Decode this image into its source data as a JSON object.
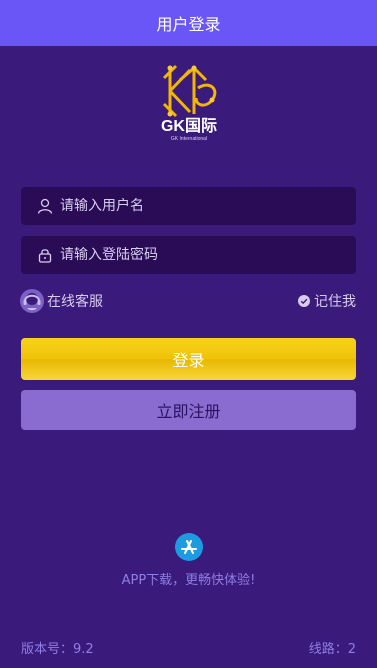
{
  "header": {
    "title": "用户登录"
  },
  "logo": {
    "name": "GK国际",
    "sub": "GK International"
  },
  "form": {
    "username_placeholder": "请输入用户名",
    "username_value": "",
    "password_placeholder": "请输入登陆密码",
    "password_value": ""
  },
  "links": {
    "customer_service": "在线客服",
    "remember_me": "记住我",
    "remember_checked": true
  },
  "buttons": {
    "login": "登录",
    "register": "立即注册"
  },
  "app": {
    "text": "APP下载，更畅快体验!"
  },
  "footer": {
    "version": "版本号：9.2",
    "line": "线路：2"
  },
  "icons": {
    "username": "user-icon",
    "password": "lock-icon",
    "customer_service": "headset-icon",
    "remember": "check-circle-icon",
    "app": "app-store-icon",
    "logo": "gk-logo-icon"
  },
  "colors": {
    "background": "#3a1a7a",
    "header": "#6a56f6",
    "input_bg": "#2a0c56",
    "login_button": "#f0c20a",
    "register_button": "#8a6cd0",
    "accent_text": "#8f7ee6",
    "app_icon": "#1e9be0"
  }
}
